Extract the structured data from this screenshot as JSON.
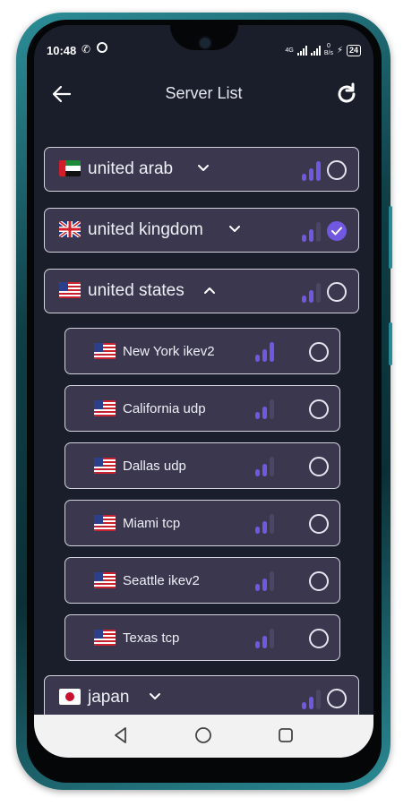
{
  "status": {
    "time": "10:48",
    "net_type": "4G",
    "speed_value": "0",
    "speed_unit": "B/s",
    "battery": "24"
  },
  "header": {
    "title": "Server List"
  },
  "countries": [
    {
      "label": "united arab",
      "expanded": false,
      "selected": false,
      "flag": "uae-flag-icon"
    },
    {
      "label": "united kingdom",
      "expanded": false,
      "selected": true,
      "flag": "uk-flag-icon"
    },
    {
      "label": "united states",
      "expanded": true,
      "selected": false,
      "flag": "us-flag-icon"
    },
    {
      "label": "japan",
      "expanded": false,
      "selected": false,
      "flag": "japan-flag-icon"
    }
  ],
  "servers": [
    {
      "label": "New York ikev2",
      "selected": false,
      "signal": 3
    },
    {
      "label": "California udp",
      "selected": false,
      "signal": 2
    },
    {
      "label": "Dallas udp",
      "selected": false,
      "signal": 2
    },
    {
      "label": "Miami tcp",
      "selected": false,
      "signal": 2
    },
    {
      "label": "Seattle ikev2",
      "selected": false,
      "signal": 2
    },
    {
      "label": "Texas tcp",
      "selected": false,
      "signal": 2
    }
  ],
  "colors": {
    "accent": "#7058e0",
    "background": "#1a1d2a",
    "row_background": "#3a374e",
    "row_border": "#d4d4de",
    "signal_dim": "#4a4664"
  }
}
